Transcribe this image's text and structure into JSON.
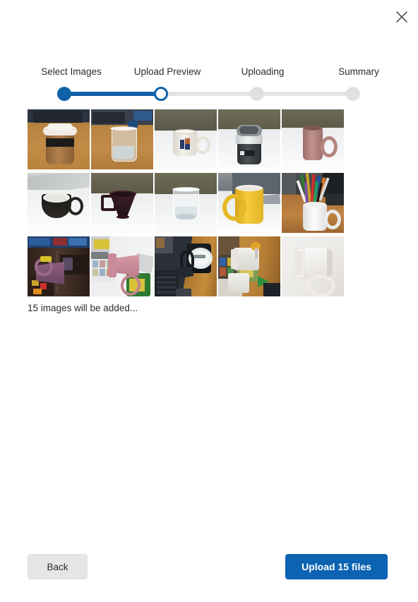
{
  "dialog": {
    "close_icon": "close-icon"
  },
  "stepper": {
    "steps": [
      {
        "label": "Select Images",
        "state": "done",
        "pos_pct": 0
      },
      {
        "label": "Upload Preview",
        "state": "current",
        "pos_pct": 33.5
      },
      {
        "label": "Uploading",
        "state": "todo",
        "pos_pct": 66.7
      },
      {
        "label": "Summary",
        "state": "todo",
        "pos_pct": 100
      }
    ],
    "active_index": 1,
    "accent_color": "#0f62a8",
    "inactive_color": "#e0e0e0"
  },
  "preview": {
    "caption": "15 images will be added...",
    "count": 15,
    "thumbnails": [
      {
        "alt": "paper coffee cup with white lid on wooden desk"
      },
      {
        "alt": "glass of water on wooden desk with keyboard"
      },
      {
        "alt": "white patterned mug on white table"
      },
      {
        "alt": "dark grey reusable travel cup with lid"
      },
      {
        "alt": "pink ceramic mug on white table"
      },
      {
        "alt": "black and white teacup on white table"
      },
      {
        "alt": "dark brown espresso cup on white table"
      },
      {
        "alt": "clear drinking glass on white table"
      },
      {
        "alt": "yellow mug on desk with keyboard"
      },
      {
        "alt": "white mug full of colored pens and pencils"
      },
      {
        "alt": "purple mug on dark shelf, rotated"
      },
      {
        "alt": "pink mug on white counter, rotated"
      },
      {
        "alt": "black mug on wooden desk with keyboard, rotated"
      },
      {
        "alt": "white mugs on wooden table, rotated"
      },
      {
        "alt": "white mug on plain background, rotated"
      }
    ]
  },
  "footer": {
    "back_label": "Back",
    "upload_label": "Upload 15 files",
    "primary_color": "#0b63b2",
    "secondary_color": "#e6e6e6"
  }
}
